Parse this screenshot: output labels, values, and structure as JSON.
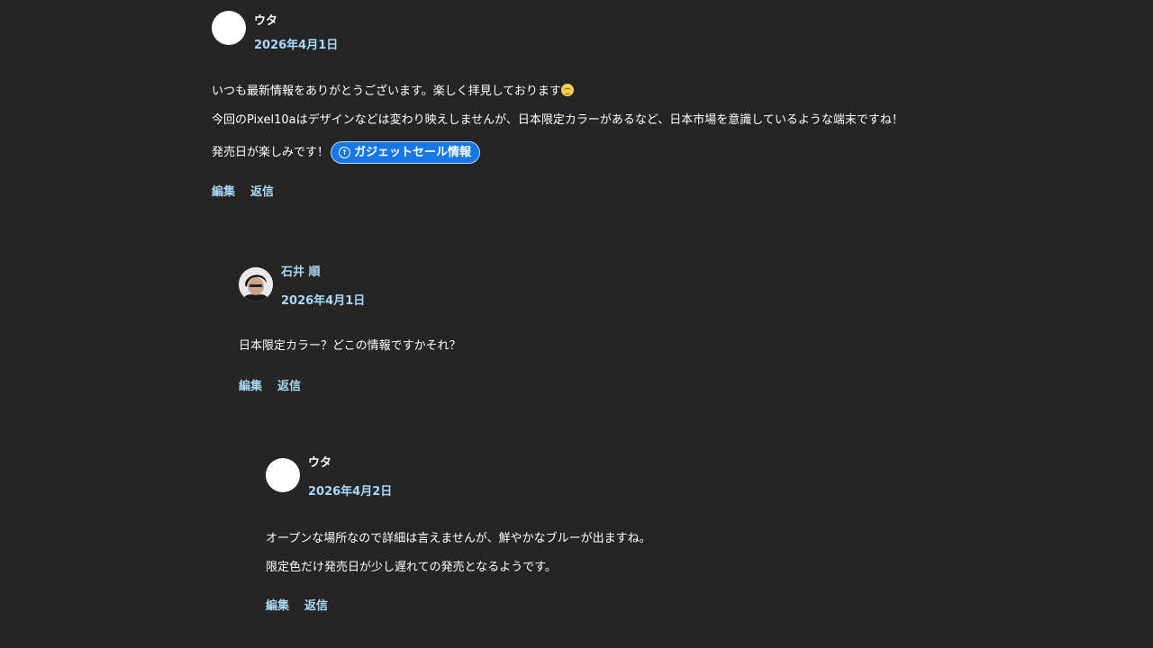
{
  "comments": [
    {
      "author": "ウタ",
      "date": "2026年4月1日",
      "paragraphs": [
        "いつも最新情報をありがとうございます。楽しく拝見しております",
        "今回のPixel10aはデザインなどは変わり映えしませんが、日本限定カラーがあるなど、日本市場を意識しているような端末ですね！",
        "発売日が楽しみです！"
      ],
      "sale_button_label": "ガジェットセール情報",
      "edit_label": "編集",
      "reply_label": "返信"
    },
    {
      "author": "石井 順",
      "date": "2026年4月1日",
      "paragraphs": [
        "日本限定カラー？どこの情報ですかそれ？"
      ],
      "edit_label": "編集",
      "reply_label": "返信"
    },
    {
      "author": "ウタ",
      "date": "2026年4月2日",
      "paragraphs": [
        "オープンな場所なので詳細は言えませんが、鮮やかなブルーが出ますね。",
        "限定色だけ発売日が少し遅れての発売となるようです。"
      ],
      "edit_label": "編集",
      "reply_label": "返信"
    }
  ],
  "icons": {
    "emoji": "smiling-face-icon",
    "sale": "arrow-up-circle-icon"
  },
  "colors": {
    "background": "#252525",
    "link": "#a9d8f5",
    "button": "#1777e6"
  }
}
